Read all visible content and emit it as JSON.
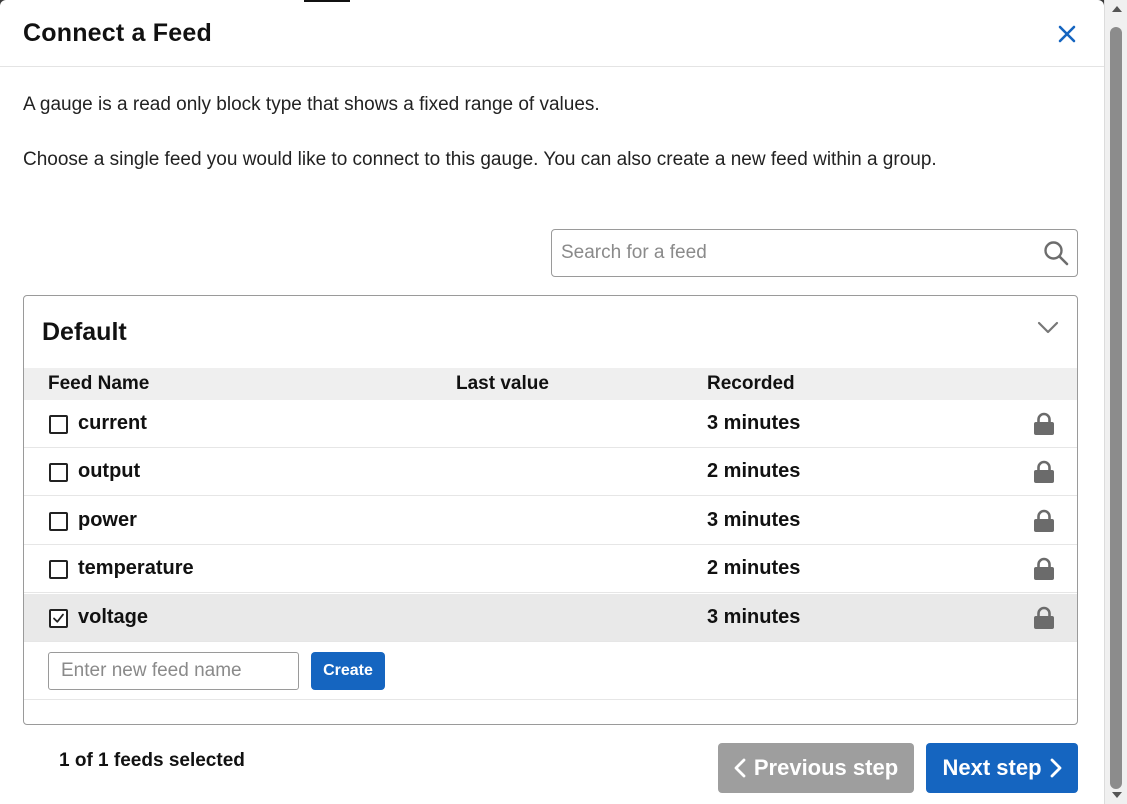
{
  "dialog": {
    "title": "Connect a Feed",
    "close_icon": "close-icon",
    "description_1": "A gauge is a read only block type that shows a fixed range of values.",
    "description_2": "Choose a single feed you would like to connect to this gauge. You can also create a new feed within a group."
  },
  "search": {
    "placeholder": "Search for a feed",
    "value": "",
    "icon": "search-icon"
  },
  "group": {
    "name": "Default",
    "expanded": true,
    "columns": {
      "feed_name": "Feed Name",
      "last_value": "Last value",
      "recorded": "Recorded"
    },
    "feeds": [
      {
        "name": "current",
        "last_value": "",
        "recorded": "3 minutes",
        "checked": false,
        "icon": "lock-icon"
      },
      {
        "name": "output",
        "last_value": "",
        "recorded": "2 minutes",
        "checked": false,
        "icon": "lock-icon"
      },
      {
        "name": "power",
        "last_value": "",
        "recorded": "3 minutes",
        "checked": false,
        "icon": "lock-icon"
      },
      {
        "name": "temperature",
        "last_value": "",
        "recorded": "2 minutes",
        "checked": false,
        "icon": "lock-icon"
      },
      {
        "name": "voltage",
        "last_value": "",
        "recorded": "3 minutes",
        "checked": true,
        "icon": "lock-icon"
      }
    ],
    "new_feed": {
      "placeholder": "Enter new feed name",
      "value": "",
      "create_label": "Create"
    }
  },
  "footer": {
    "selected_text": "1 of 1 feeds selected",
    "previous_label": "Previous step",
    "next_label": "Next step"
  },
  "colors": {
    "accent": "#1565c0",
    "disabled": "#9e9e9e",
    "selected_row": "#e9e9e9",
    "header_row": "#efefef"
  }
}
